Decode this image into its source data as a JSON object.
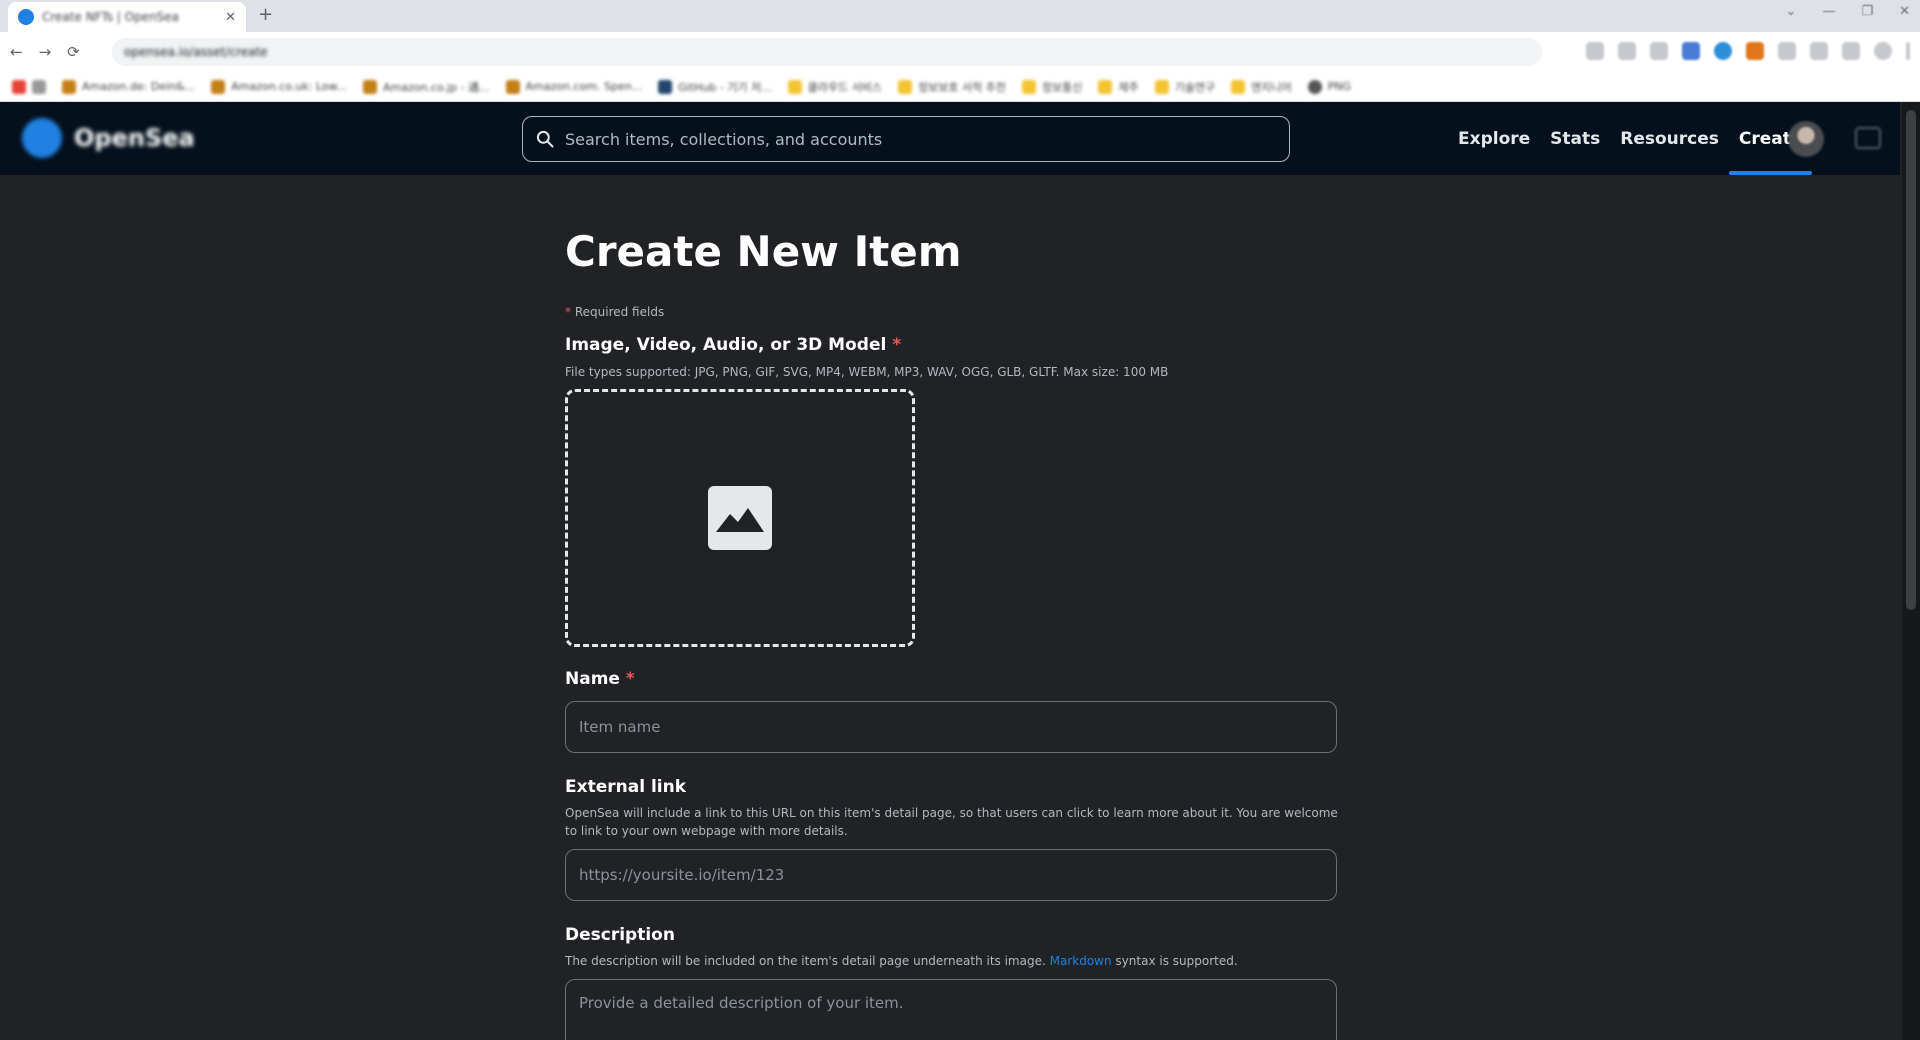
{
  "browser": {
    "tab_title": "Create NFTs | OpenSea",
    "url": "opensea.io/asset/create",
    "bookmarks": [
      "Amazon.de: Dein&...",
      "Amazon.co.uk: Low...",
      "Amazon.co.jp - 通...",
      "Amazon.com. Spen...",
      "GitHub - 기기 저...",
      "클라우드 서비스",
      "정보보호 서적 추천",
      "정보통신",
      "제주",
      "기술연구",
      "엔지니어",
      "PNG"
    ]
  },
  "nav": {
    "brand": "OpenSea",
    "search_placeholder": "Search items, collections, and accounts",
    "links": [
      "Explore",
      "Stats",
      "Resources",
      "Create"
    ],
    "active_link": "Create"
  },
  "form": {
    "title": "Create New Item",
    "required_note": "Required fields",
    "required_marker": "*",
    "media": {
      "label": "Image, Video, Audio, or 3D Model",
      "hint": "File types supported: JPG, PNG, GIF, SVG, MP4, WEBM, MP3, WAV, OGG, GLB, GLTF. Max size: 100 MB",
      "icon": "image-icon"
    },
    "name": {
      "label": "Name",
      "placeholder": "Item name"
    },
    "external_link": {
      "label": "External link",
      "hint": "OpenSea will include a link to this URL on this item's detail page, so that users can click to learn more about it. You are welcome to link to your own webpage with more details.",
      "placeholder": "https://yoursite.io/item/123"
    },
    "description": {
      "label": "Description",
      "hint_before": "The description will be included on the item's detail page underneath its image.",
      "hint_link": "Markdown",
      "hint_after": "syntax is supported.",
      "placeholder": "Provide a detailed description of your item."
    }
  },
  "colors": {
    "accent": "#2081e2",
    "nav_bg": "#04111d",
    "page_bg": "#202225",
    "required": "#eb5757"
  }
}
